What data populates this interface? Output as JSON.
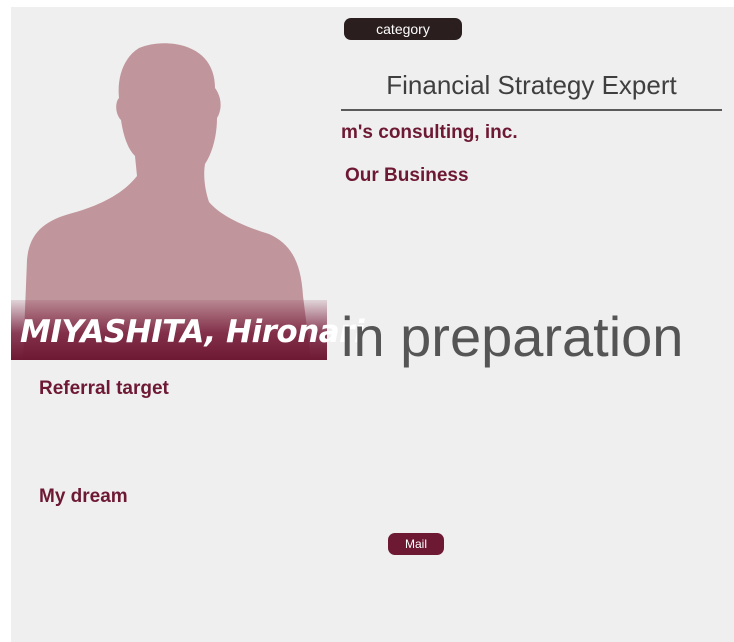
{
  "profile": {
    "name": "MIYASHITA, Hironari",
    "category_label": "category",
    "title": "Financial Strategy Expert",
    "company": "m's consulting, inc.",
    "business_heading": "Our Business",
    "status_text": "in preparation",
    "referral_heading": "Referral target",
    "dream_heading": "My dream",
    "mail_label": "Mail"
  },
  "photo": {
    "icon": "person-silhouette-icon",
    "color": "#c0959b"
  },
  "colors": {
    "accent": "#6e1934",
    "pill_dark": "#2a1e1e",
    "card_background": "#efefef",
    "status_text": "#555555"
  }
}
